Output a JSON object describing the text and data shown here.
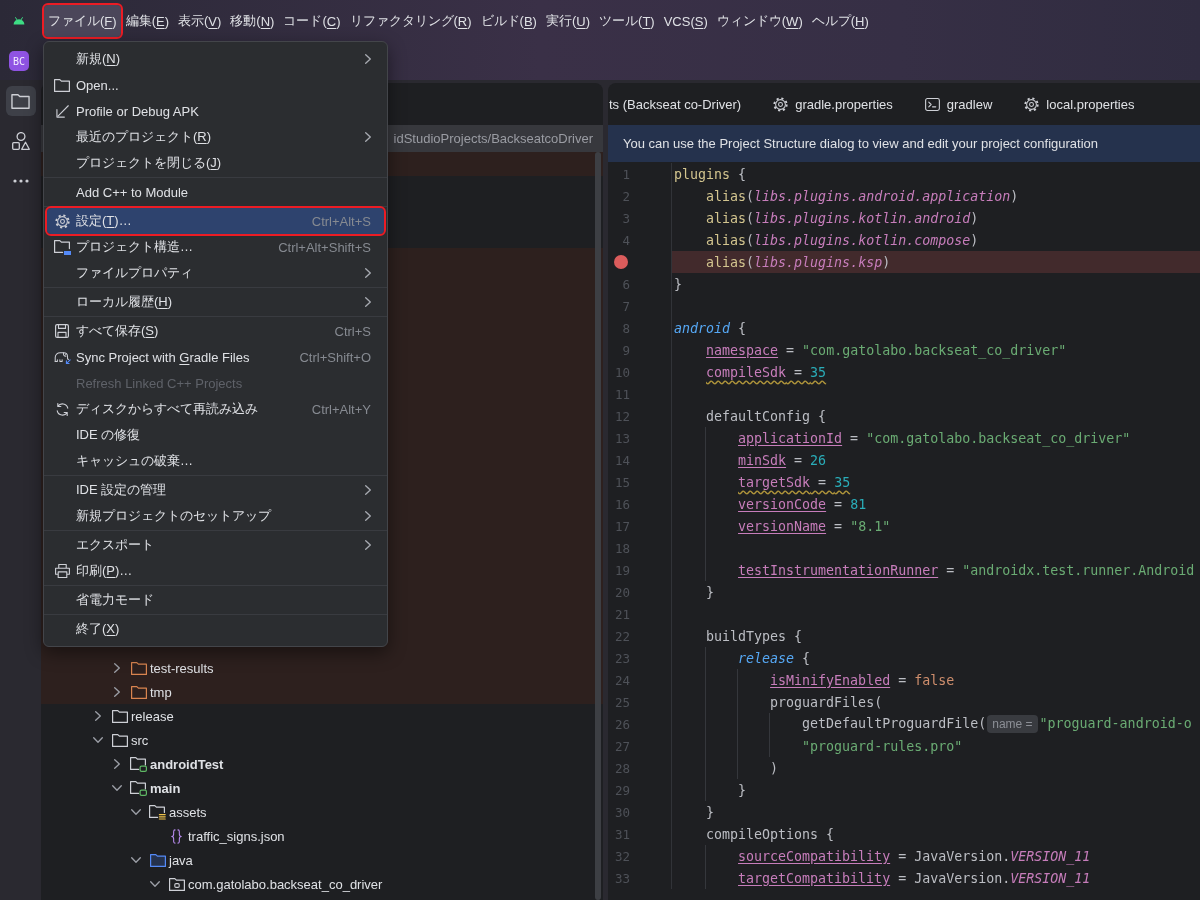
{
  "menu_bar": {
    "items": [
      {
        "label": {
          "before": "ファイル(",
          "mnemonic": "F",
          "after": ")"
        },
        "selected": true,
        "annotated": true
      },
      {
        "label": {
          "before": "編集(",
          "mnemonic": "E",
          "after": ")"
        },
        "selected": false,
        "annotated": false
      },
      {
        "label": {
          "before": "表示(",
          "mnemonic": "V",
          "after": ")"
        },
        "selected": false,
        "annotated": false
      },
      {
        "label": {
          "before": "移動(",
          "mnemonic": "N",
          "after": ")"
        },
        "selected": false,
        "annotated": false
      },
      {
        "label": {
          "before": "コード(",
          "mnemonic": "C",
          "after": ")"
        },
        "selected": false,
        "annotated": false
      },
      {
        "label": {
          "before": "リファクタリング(",
          "mnemonic": "R",
          "after": ")"
        },
        "selected": false,
        "annotated": false
      },
      {
        "label": {
          "before": "ビルド(",
          "mnemonic": "B",
          "after": ")"
        },
        "selected": false,
        "annotated": false
      },
      {
        "label": {
          "before": "実行(",
          "mnemonic": "U",
          "after": ")"
        },
        "selected": false,
        "annotated": false
      },
      {
        "label": {
          "before": "ツール(",
          "mnemonic": "T",
          "after": ")"
        },
        "selected": false,
        "annotated": false
      },
      {
        "label": {
          "before": "VCS(",
          "mnemonic": "S",
          "after": ")"
        },
        "selected": false,
        "annotated": false
      },
      {
        "label": {
          "before": "ウィンドウ(",
          "mnemonic": "W",
          "after": ")"
        },
        "selected": false,
        "annotated": false
      },
      {
        "label": {
          "before": "ヘルプ(",
          "mnemonic": "H",
          "after": ")"
        },
        "selected": false,
        "annotated": false
      }
    ]
  },
  "file_menu": {
    "items": [
      {
        "kind": "item",
        "label": {
          "before": "新規(",
          "mnemonic": "N",
          "after": ")"
        },
        "submenu": true,
        "selected": false,
        "disabled": false,
        "annotated": false
      },
      {
        "kind": "item",
        "label": "Open...",
        "submenu": false,
        "selected": false,
        "disabled": false,
        "annotated": false
      },
      {
        "kind": "item",
        "label": "Profile or Debug APK",
        "submenu": false,
        "selected": false,
        "disabled": false,
        "annotated": false
      },
      {
        "kind": "item",
        "label": {
          "before": "最近のプロジェクト(",
          "mnemonic": "R",
          "after": ")"
        },
        "submenu": true,
        "selected": false,
        "disabled": false,
        "annotated": false
      },
      {
        "kind": "item",
        "label": {
          "before": "プロジェクトを閉じる(",
          "mnemonic": "J",
          "after": ")"
        },
        "submenu": false,
        "selected": false,
        "disabled": false,
        "annotated": false
      },
      {
        "kind": "separator"
      },
      {
        "kind": "item",
        "label": "Add C++ to Module",
        "submenu": false,
        "selected": false,
        "disabled": false,
        "annotated": false
      },
      {
        "kind": "separator"
      },
      {
        "kind": "item",
        "label": {
          "before": "設定(",
          "mnemonic": "T",
          "after": ")…"
        },
        "shortcut": "Ctrl+Alt+S",
        "submenu": false,
        "selected": true,
        "disabled": false,
        "annotated": true
      },
      {
        "kind": "item",
        "label": "プロジェクト構造…",
        "shortcut": "Ctrl+Alt+Shift+S",
        "submenu": false,
        "selected": false,
        "disabled": false,
        "annotated": false
      },
      {
        "kind": "item",
        "label": "ファイルプロパティ",
        "submenu": true,
        "selected": false,
        "disabled": false,
        "annotated": false
      },
      {
        "kind": "separator"
      },
      {
        "kind": "item",
        "label": {
          "before": "ローカル履歴(",
          "mnemonic": "H",
          "after": ")"
        },
        "submenu": true,
        "selected": false,
        "disabled": false,
        "annotated": false
      },
      {
        "kind": "separator"
      },
      {
        "kind": "item",
        "label": {
          "before": "すべて保存(",
          "mnemonic": "S",
          "after": ")"
        },
        "shortcut": "Ctrl+S",
        "submenu": false,
        "selected": false,
        "disabled": false,
        "annotated": false
      },
      {
        "kind": "item",
        "label": {
          "before": "Sync Project with ",
          "mnemonic": "G",
          "after": "radle Files"
        },
        "shortcut": "Ctrl+Shift+O",
        "submenu": false,
        "selected": false,
        "disabled": false,
        "annotated": false
      },
      {
        "kind": "item",
        "label": "Refresh Linked C++ Projects",
        "submenu": false,
        "selected": false,
        "disabled": true,
        "annotated": false
      },
      {
        "kind": "item",
        "label": "ディスクからすべて再読み込み",
        "shortcut": "Ctrl+Alt+Y",
        "submenu": false,
        "selected": false,
        "disabled": false,
        "annotated": false
      },
      {
        "kind": "item",
        "label": "IDE の修復",
        "submenu": false,
        "selected": false,
        "disabled": false,
        "annotated": false
      },
      {
        "kind": "item",
        "label": "キャッシュの破棄…",
        "submenu": false,
        "selected": false,
        "disabled": false,
        "annotated": false
      },
      {
        "kind": "separator"
      },
      {
        "kind": "item",
        "label": "IDE 設定の管理",
        "submenu": true,
        "selected": false,
        "disabled": false,
        "annotated": false
      },
      {
        "kind": "item",
        "label": "新規プロジェクトのセットアップ",
        "submenu": true,
        "selected": false,
        "disabled": false,
        "annotated": false
      },
      {
        "kind": "separator"
      },
      {
        "kind": "item",
        "label": "エクスポート",
        "submenu": true,
        "selected": false,
        "disabled": false,
        "annotated": false
      },
      {
        "kind": "item",
        "label": {
          "before": "印刷(",
          "mnemonic": "P",
          "after": ")…"
        },
        "submenu": false,
        "selected": false,
        "disabled": false,
        "annotated": false
      },
      {
        "kind": "separator"
      },
      {
        "kind": "item",
        "label": "省電力モード",
        "submenu": false,
        "selected": false,
        "disabled": false,
        "annotated": false
      },
      {
        "kind": "separator"
      },
      {
        "kind": "item",
        "label": {
          "before": "終了(",
          "mnemonic": "X",
          "after": ")"
        },
        "submenu": false,
        "selected": false,
        "disabled": false,
        "annotated": false
      }
    ]
  },
  "project_badge": "BC",
  "tool_strip": [
    {
      "selected": true
    },
    {
      "selected": false
    },
    {
      "selected": false
    }
  ],
  "project_panel": {
    "root_path": "idStudioProjects/BackseatcoDriver",
    "covered_rows": [
      {
        "excluded": true
      },
      {
        "excluded": false
      },
      {
        "excluded": false
      },
      {
        "excluded": false
      },
      {
        "excluded": true
      },
      {
        "excluded": true
      },
      {
        "excluded": true
      },
      {
        "excluded": true
      },
      {
        "excluded": true
      },
      {
        "excluded": true
      },
      {
        "excluded": true
      },
      {
        "excluded": true
      },
      {
        "excluded": true
      },
      {
        "excluded": true
      },
      {
        "excluded": true
      },
      {
        "excluded": true
      },
      {
        "excluded": true
      },
      {
        "excluded": true
      },
      {
        "excluded": true
      },
      {
        "excluded": true
      },
      {
        "excluded": true
      }
    ],
    "tree": [
      {
        "children": [
          {
            "label": "test-results",
            "kind": "folder",
            "expanded": false,
            "excluded": true
          },
          {
            "label": "tmp",
            "kind": "folder",
            "expanded": false,
            "excluded": true
          }
        ]
      },
      {
        "label": "release",
        "kind": "folder",
        "expanded": false,
        "excluded": false
      },
      {
        "label": "src",
        "kind": "folder",
        "expanded": true,
        "excluded": false,
        "children": [
          {
            "label": "androidTest",
            "kind": "source-set",
            "expanded": false,
            "excluded": false
          },
          {
            "label": "main",
            "kind": "source-set",
            "expanded": true,
            "excluded": false,
            "children": [
              {
                "label": "assets",
                "kind": "assets-folder",
                "expanded": true,
                "excluded": false,
                "children": [
                  {
                    "label": "traffic_signs.json",
                    "kind": "json-file",
                    "excluded": false
                  }
                ]
              },
              {
                "label": "java",
                "kind": "source-root",
                "expanded": true,
                "excluded": false,
                "children": [
                  {
                    "label": "com.gatolabo.backseat_co_driver",
                    "kind": "package",
                    "expanded": true,
                    "excluded": false
                  }
                ]
              }
            ]
          }
        ]
      }
    ]
  },
  "editor": {
    "tabs": [
      {
        "label": "ts (Backseat co-Driver)",
        "selected": false
      },
      {
        "label": "gradle.properties",
        "selected": false
      },
      {
        "label": "gradlew",
        "selected": false
      },
      {
        "label": "local.properties",
        "selected": false
      }
    ],
    "banner": "You can use the Project Structure dialog to view and edit your project configuration",
    "lines": [
      {
        "number": "1",
        "breakpoint": false,
        "warning": false,
        "tokens": [
          {
            "text": "plugins",
            "kind": "call"
          },
          {
            "text": " {",
            "kind": "plain"
          }
        ]
      },
      {
        "number": "2",
        "breakpoint": false,
        "warning": false,
        "tokens": [
          {
            "text": "    alias",
            "kind": "call"
          },
          {
            "text": "(",
            "kind": "plain"
          },
          {
            "text": "libs.plugins.android.application",
            "kind": "ref"
          },
          {
            "text": ")",
            "kind": "plain"
          }
        ]
      },
      {
        "number": "3",
        "breakpoint": false,
        "warning": false,
        "tokens": [
          {
            "text": "    alias",
            "kind": "call"
          },
          {
            "text": "(",
            "kind": "plain"
          },
          {
            "text": "libs.plugins.kotlin.android",
            "kind": "ref"
          },
          {
            "text": ")",
            "kind": "plain"
          }
        ]
      },
      {
        "number": "4",
        "breakpoint": false,
        "warning": false,
        "tokens": [
          {
            "text": "    alias",
            "kind": "call"
          },
          {
            "text": "(",
            "kind": "plain"
          },
          {
            "text": "libs.plugins.kotlin.compose",
            "kind": "ref"
          },
          {
            "text": ")",
            "kind": "plain"
          }
        ]
      },
      {
        "breakpoint": true,
        "warning": false,
        "tokens": [
          {
            "text": "    alias",
            "kind": "call"
          },
          {
            "text": "(",
            "kind": "plain"
          },
          {
            "text": "libs.plugins.ksp",
            "kind": "ref"
          },
          {
            "text": ")",
            "kind": "plain"
          }
        ]
      },
      {
        "number": "6",
        "breakpoint": false,
        "warning": false,
        "tokens": [
          {
            "text": "}",
            "kind": "plain"
          }
        ]
      },
      {
        "number": "7",
        "breakpoint": false,
        "warning": false
      },
      {
        "number": "8",
        "breakpoint": false,
        "warning": false,
        "tokens": [
          {
            "text": "android",
            "kind": "scope"
          },
          {
            "text": " {",
            "kind": "plain"
          }
        ]
      },
      {
        "number": "9",
        "breakpoint": false,
        "warning": false,
        "tokens": [
          {
            "text": "    namespace",
            "kind": "prop"
          },
          {
            "text": " = ",
            "kind": "plain"
          },
          {
            "text": "\"com.gatolabo.backseat_co_driver\"",
            "kind": "string"
          }
        ]
      },
      {
        "number": "10",
        "breakpoint": false,
        "warning": true,
        "tokens": [
          {
            "text": "    compileSdk",
            "kind": "prop"
          },
          {
            "text": " = ",
            "kind": "plain"
          },
          {
            "text": "35",
            "kind": "number"
          }
        ]
      },
      {
        "number": "11",
        "breakpoint": false,
        "warning": false
      },
      {
        "number": "12",
        "breakpoint": false,
        "warning": false,
        "tokens": [
          {
            "text": "    defaultConfig {",
            "kind": "plain"
          }
        ]
      },
      {
        "number": "13",
        "breakpoint": false,
        "warning": false,
        "tokens": [
          {
            "text": "        applicationId",
            "kind": "prop"
          },
          {
            "text": " = ",
            "kind": "plain"
          },
          {
            "text": "\"com.gatolabo.backseat_co_driver\"",
            "kind": "string"
          }
        ]
      },
      {
        "number": "14",
        "breakpoint": false,
        "warning": false,
        "tokens": [
          {
            "text": "        minSdk",
            "kind": "prop"
          },
          {
            "text": " = ",
            "kind": "plain"
          },
          {
            "text": "26",
            "kind": "number"
          }
        ]
      },
      {
        "number": "15",
        "breakpoint": false,
        "warning": true,
        "tokens": [
          {
            "text": "        targetSdk",
            "kind": "prop"
          },
          {
            "text": " = ",
            "kind": "plain"
          },
          {
            "text": "35",
            "kind": "number"
          }
        ]
      },
      {
        "number": "16",
        "breakpoint": false,
        "warning": false,
        "tokens": [
          {
            "text": "        versionCode",
            "kind": "prop"
          },
          {
            "text": " = ",
            "kind": "plain"
          },
          {
            "text": "81",
            "kind": "number"
          }
        ]
      },
      {
        "number": "17",
        "breakpoint": false,
        "warning": false,
        "tokens": [
          {
            "text": "        versionName",
            "kind": "prop"
          },
          {
            "text": " = ",
            "kind": "plain"
          },
          {
            "text": "\"8.1\"",
            "kind": "string"
          }
        ]
      },
      {
        "number": "18",
        "breakpoint": false,
        "warning": false
      },
      {
        "number": "19",
        "breakpoint": false,
        "warning": false,
        "tokens": [
          {
            "text": "        testInstrumentationRunner",
            "kind": "prop"
          },
          {
            "text": " = ",
            "kind": "plain"
          },
          {
            "text": "\"androidx.test.runner.Android",
            "kind": "string"
          }
        ]
      },
      {
        "number": "20",
        "breakpoint": false,
        "warning": false,
        "tokens": [
          {
            "text": "    }",
            "kind": "plain"
          }
        ]
      },
      {
        "number": "21",
        "breakpoint": false,
        "warning": false
      },
      {
        "number": "22",
        "breakpoint": false,
        "warning": false,
        "tokens": [
          {
            "text": "    buildTypes {",
            "kind": "plain"
          }
        ]
      },
      {
        "number": "23",
        "breakpoint": false,
        "warning": false,
        "tokens": [
          {
            "text": "        release",
            "kind": "scope"
          },
          {
            "text": " {",
            "kind": "plain"
          }
        ]
      },
      {
        "number": "24",
        "breakpoint": false,
        "warning": false,
        "tokens": [
          {
            "text": "            isMinifyEnabled",
            "kind": "prop"
          },
          {
            "text": " = ",
            "kind": "plain"
          },
          {
            "text": "false",
            "kind": "literal"
          }
        ]
      },
      {
        "number": "25",
        "breakpoint": false,
        "warning": false,
        "tokens": [
          {
            "text": "            proguardFiles(",
            "kind": "plain"
          }
        ]
      },
      {
        "number": "26",
        "breakpoint": false,
        "warning": false,
        "tokens": [
          {
            "text": "                getDefaultProguardFile(",
            "kind": "plain"
          },
          {
            "text": "name =",
            "kind": "hint"
          },
          {
            "text": "\"proguard-android-o",
            "kind": "string"
          }
        ]
      },
      {
        "number": "27",
        "breakpoint": false,
        "warning": false,
        "tokens": [
          {
            "text": "                \"proguard-rules.pro\"",
            "kind": "string"
          }
        ]
      },
      {
        "number": "28",
        "breakpoint": false,
        "warning": false,
        "tokens": [
          {
            "text": "            )",
            "kind": "plain"
          }
        ]
      },
      {
        "number": "29",
        "breakpoint": false,
        "warning": false,
        "tokens": [
          {
            "text": "        }",
            "kind": "plain"
          }
        ]
      },
      {
        "number": "30",
        "breakpoint": false,
        "warning": false,
        "tokens": [
          {
            "text": "    }",
            "kind": "plain"
          }
        ]
      },
      {
        "number": "31",
        "breakpoint": false,
        "warning": false,
        "tokens": [
          {
            "text": "    compileOptions {",
            "kind": "plain"
          }
        ]
      },
      {
        "number": "32",
        "breakpoint": false,
        "warning": false,
        "tokens": [
          {
            "text": "        sourceCompatibility",
            "kind": "prop"
          },
          {
            "text": " = ",
            "kind": "plain"
          },
          {
            "text": "JavaVersion.",
            "kind": "plain"
          },
          {
            "text": "VERSION_11",
            "kind": "const"
          }
        ]
      },
      {
        "number": "33",
        "breakpoint": false,
        "warning": false,
        "tokens": [
          {
            "text": "        targetCompatibility",
            "kind": "prop"
          },
          {
            "text": " = ",
            "kind": "plain"
          },
          {
            "text": "JavaVersion.",
            "kind": "plain"
          },
          {
            "text": "VERSION_11",
            "kind": "const"
          }
        ]
      }
    ]
  }
}
